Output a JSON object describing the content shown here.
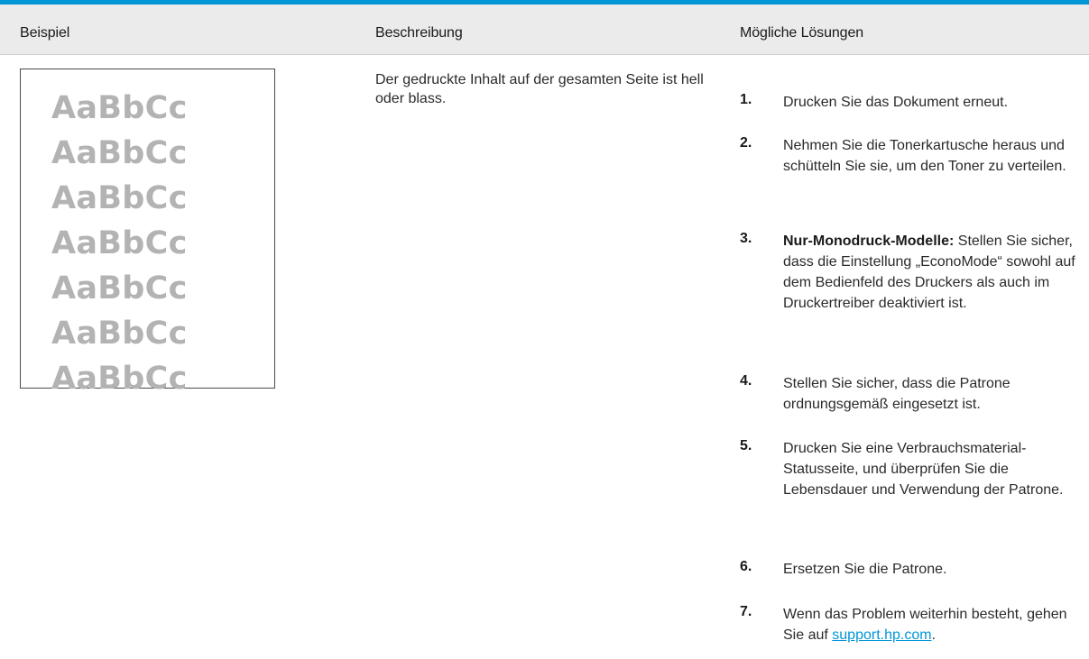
{
  "colors": {
    "accent": "#0096d6",
    "header_background": "#ebebeb",
    "sample_text_gray": "#b3b3b3"
  },
  "table": {
    "headers": {
      "example": "Beispiel",
      "description": "Beschreibung",
      "solutions": "Mögliche Lösungen"
    }
  },
  "example": {
    "sample_lines": [
      "AaBbCc",
      "AaBbCc",
      "AaBbCc",
      "AaBbCc",
      "AaBbCc",
      "AaBbCc",
      "AaBbCc"
    ]
  },
  "description": {
    "text": "Der gedruckte Inhalt auf der gesamten Seite ist hell oder blass."
  },
  "solutions": [
    {
      "number": "1.",
      "text": "Drucken Sie das Dokument erneut."
    },
    {
      "number": "2.",
      "text": "Nehmen Sie die Tonerkartusche heraus und schütteln Sie sie, um den Toner zu verteilen."
    },
    {
      "number": "3.",
      "bold_prefix": "Nur-Monodruck-Modelle:",
      "text": " Stellen Sie sicher, dass die Einstellung „EconoMode“ sowohl auf dem Bedienfeld des Druckers als auch im Druckertreiber deaktiviert ist."
    },
    {
      "number": "4.",
      "text": "Stellen Sie sicher, dass die Patrone ordnungsgemäß eingesetzt ist."
    },
    {
      "number": "5.",
      "text": "Drucken Sie eine Verbrauchsmaterial-Statusseite, und überprüfen Sie die Lebensdauer und Verwendung der Patrone."
    },
    {
      "number": "6.",
      "text": "Ersetzen Sie die Patrone."
    },
    {
      "number": "7.",
      "text": "Wenn das Problem weiterhin besteht, gehen Sie auf ",
      "link_text": "support.hp.com",
      "text_after": "."
    }
  ]
}
